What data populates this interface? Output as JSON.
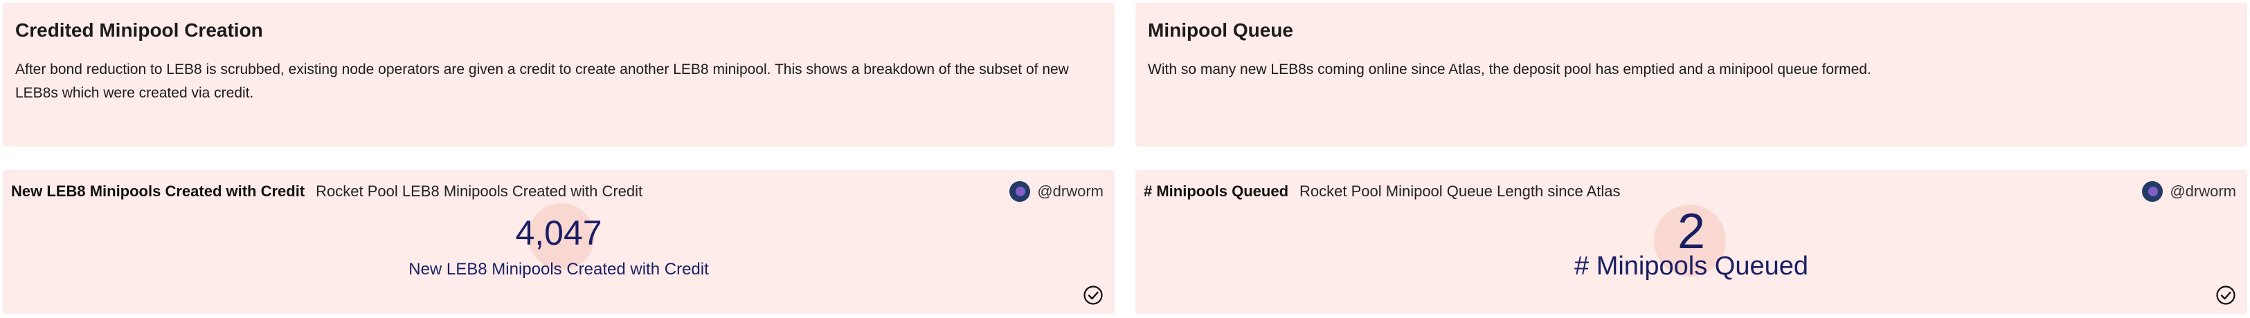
{
  "text_widgets": [
    {
      "title": "Credited Minipool Creation",
      "body": "After bond reduction to LEB8 is scrubbed, existing node operators are given a credit to create another LEB8 minipool. This shows a breakdown of the subset of new LEB8s which were created via credit."
    },
    {
      "title": "Minipool Queue",
      "body": "With so many new LEB8s coming online since Atlas, the deposit pool has emptied and a minipool queue formed."
    }
  ],
  "viz_widgets": [
    {
      "name": "New LEB8 Minipools Created with Credit",
      "query": "Rocket Pool LEB8 Minipools Created with Credit",
      "author": "@drworm",
      "counter_value": "4,047",
      "counter_label": "New LEB8 Minipools Created with Credit"
    },
    {
      "name": "# Minipools Queued",
      "query": "Rocket Pool Minipool Queue Length since Atlas",
      "author": "@drworm",
      "counter_value": "2",
      "counter_label": "# Minipools Queued"
    }
  ],
  "icons": {
    "avatar": "user-avatar",
    "status": "check-circle-icon"
  },
  "colors": {
    "panel_bg": "#fdecea",
    "counter_text": "#1a1f64"
  }
}
